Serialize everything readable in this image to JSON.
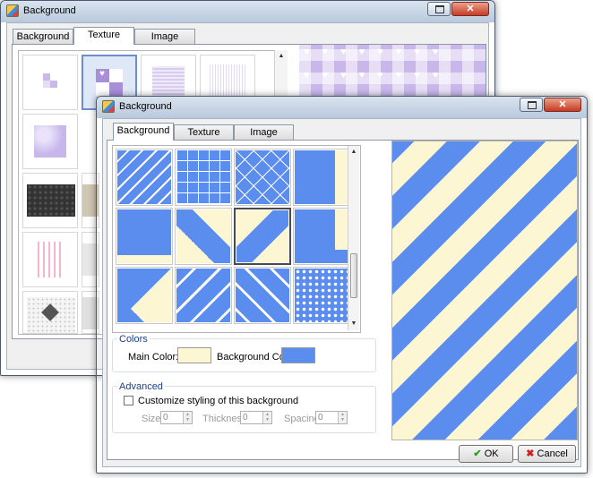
{
  "back_window": {
    "title": "Background",
    "tabs": [
      {
        "label": "Background",
        "active": false
      },
      {
        "label": "Texture",
        "active": true
      },
      {
        "label": "Image",
        "active": false
      }
    ]
  },
  "front_window": {
    "title": "Background",
    "tabs": [
      {
        "label": "Background",
        "active": true
      },
      {
        "label": "Texture",
        "active": false
      },
      {
        "label": "Image",
        "active": false
      }
    ],
    "selected_pattern": "diagonal-stripes",
    "colors": {
      "group_label": "Colors",
      "main_label": "Main Color:",
      "main_value": "#fdf6d3",
      "background_label": "Background Color:",
      "background_value": "#5b8def"
    },
    "advanced": {
      "group_label": "Advanced",
      "checkbox_label": "Customize styling of this background",
      "checked": false,
      "size_label": "Size:",
      "size_value": "0",
      "thickness_label": "Thickness:",
      "thickness_value": "0",
      "spacing_label": "Spacing:",
      "spacing_value": "0"
    },
    "ok_label": "OK",
    "cancel_label": "Cancel"
  },
  "icons": [
    "app-icon",
    "restore-icon",
    "close-icon",
    "check-icon",
    "cancel-icon",
    "scroll-up-icon",
    "scroll-down-icon"
  ]
}
